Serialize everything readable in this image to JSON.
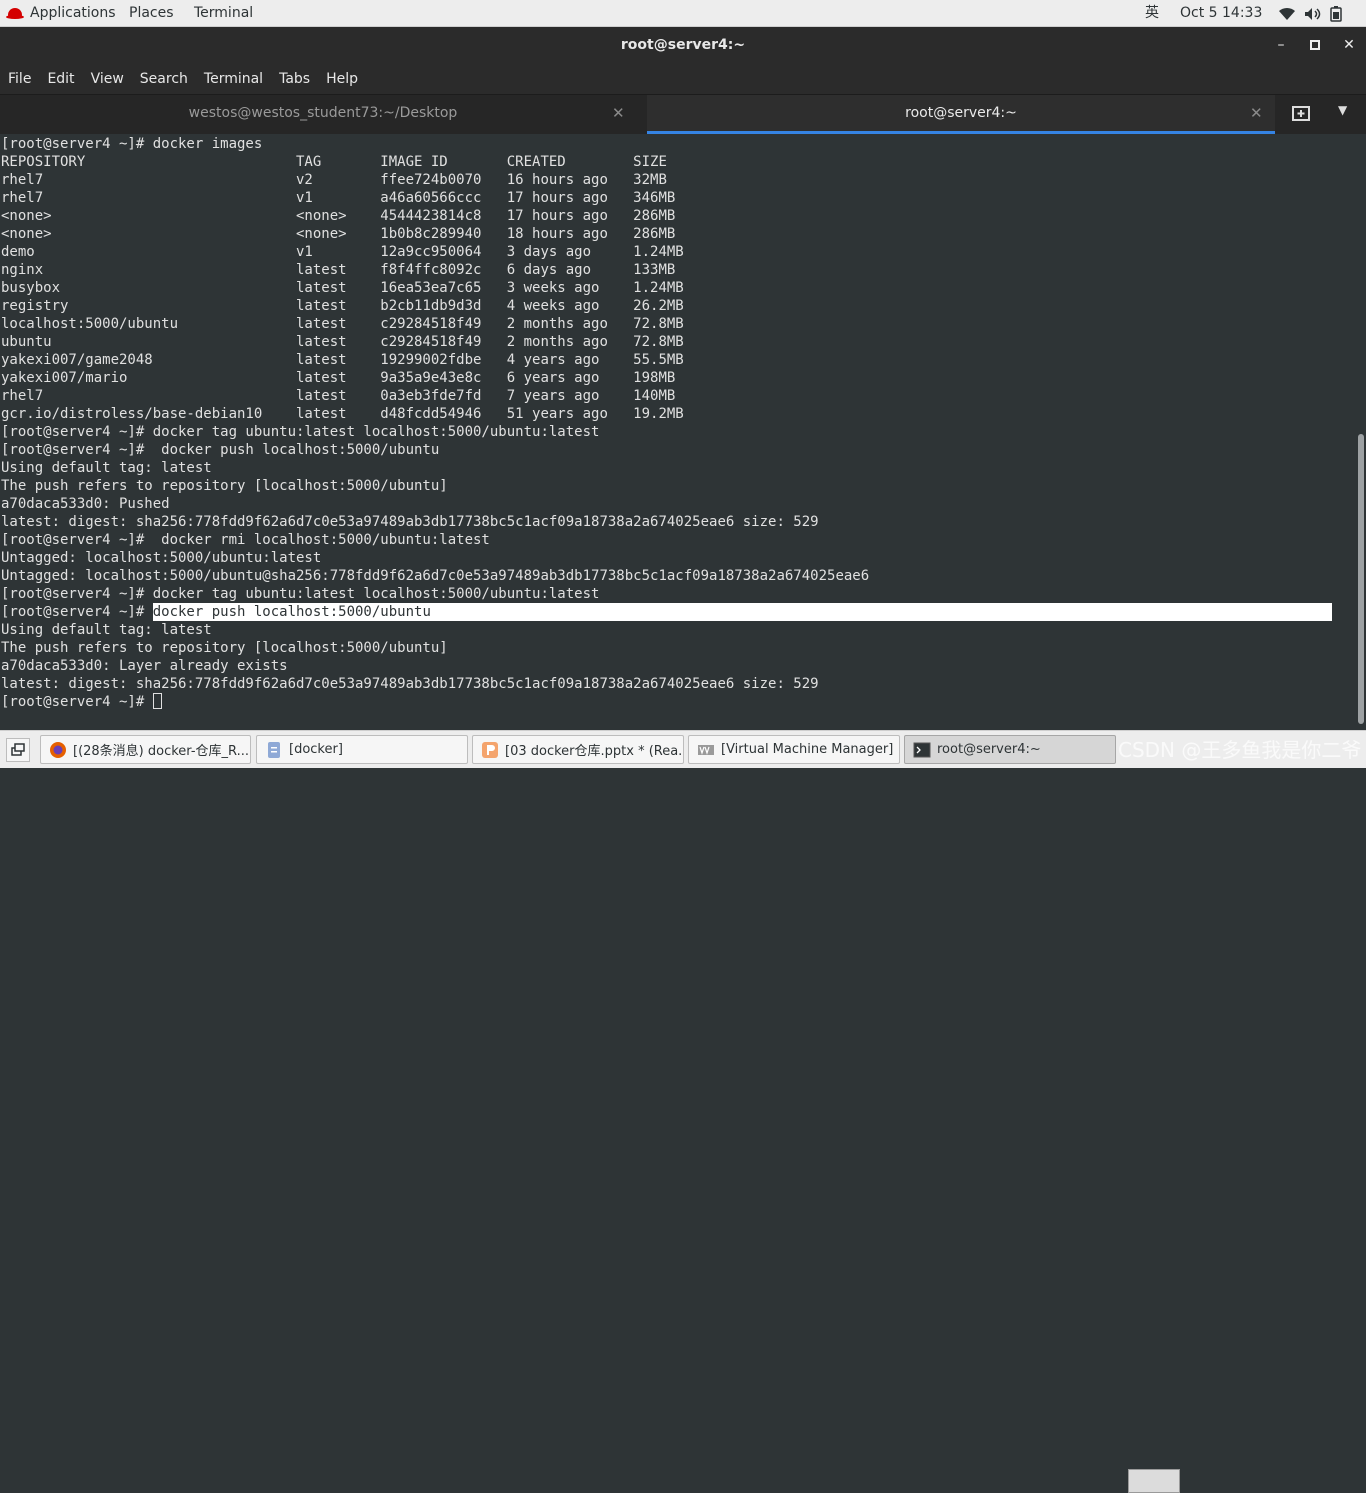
{
  "topbar": {
    "applications": "Applications",
    "places": "Places",
    "terminal": "Terminal",
    "input_method": "英",
    "clock": "Oct 5  14:33",
    "icons": [
      "wifi-icon",
      "volume-icon",
      "battery-icon"
    ]
  },
  "window": {
    "title": "root@server4:~",
    "controls": [
      "minimize-icon",
      "maximize-icon",
      "close-icon"
    ]
  },
  "menubar": [
    "File",
    "Edit",
    "View",
    "Search",
    "Terminal",
    "Tabs",
    "Help"
  ],
  "tabs": [
    {
      "label": "westos@westos_student73:~/Desktop",
      "active": false
    },
    {
      "label": "root@server4:~",
      "active": true
    }
  ],
  "terminal": {
    "lines": [
      "[root@server4 ~]# docker images",
      "REPOSITORY                         TAG       IMAGE ID       CREATED        SIZE",
      "rhel7                              v2        ffee724b0070   16 hours ago   32MB",
      "rhel7                              v1        a46a60566ccc   17 hours ago   346MB",
      "<none>                             <none>    4544423814c8   17 hours ago   286MB",
      "<none>                             <none>    1b0b8c289940   18 hours ago   286MB",
      "demo                               v1        12a9cc950064   3 days ago     1.24MB",
      "nginx                              latest    f8f4ffc8092c   6 days ago     133MB",
      "busybox                            latest    16ea53ea7c65   3 weeks ago    1.24MB",
      "registry                           latest    b2cb11db9d3d   4 weeks ago    26.2MB",
      "localhost:5000/ubuntu              latest    c29284518f49   2 months ago   72.8MB",
      "ubuntu                             latest    c29284518f49   2 months ago   72.8MB",
      "yakexi007/game2048                 latest    19299002fdbe   4 years ago    55.5MB",
      "yakexi007/mario                    latest    9a35a9e43e8c   6 years ago    198MB",
      "rhel7                              latest    0a3eb3fde7fd   7 years ago    140MB",
      "gcr.io/distroless/base-debian10    latest    d48fcdd54946   51 years ago   19.2MB",
      "[root@server4 ~]# docker tag ubuntu:latest localhost:5000/ubuntu:latest",
      "[root@server4 ~]#  docker push localhost:5000/ubuntu",
      "Using default tag: latest",
      "The push refers to repository [localhost:5000/ubuntu]",
      "a70daca533d0: Pushed",
      "latest: digest: sha256:778fdd9f62a6d7c0e53a97489ab3db17738bc5c1acf09a18738a2a674025eae6 size: 529",
      "[root@server4 ~]#  docker rmi localhost:5000/ubuntu:latest",
      "Untagged: localhost:5000/ubuntu:latest",
      "Untagged: localhost:5000/ubuntu@sha256:778fdd9f62a6d7c0e53a97489ab3db17738bc5c1acf09a18738a2a674025eae6",
      "[root@server4 ~]# docker tag ubuntu:latest localhost:5000/ubuntu:latest"
    ],
    "highlight_prompt": "[root@server4 ~]# ",
    "highlight_text": "docker push localhost:5000/ubuntu",
    "after_lines": [
      "Using default tag: latest",
      "The push refers to repository [localhost:5000/ubuntu]",
      "a70daca533d0: Layer already exists",
      "latest: digest: sha256:778fdd9f62a6d7c0e53a97489ab3db17738bc5c1acf09a18738a2a674025eae6 size: 529"
    ],
    "final_prompt": "[root@server4 ~]# "
  },
  "taskbar": [
    {
      "label": "[(28条消息) docker-仓库_R...",
      "icon": "firefox-icon",
      "active": false
    },
    {
      "label": "[docker]",
      "icon": "document-icon",
      "active": false
    },
    {
      "label": "[03 docker仓库.pptx * (Rea...",
      "icon": "presentation-icon",
      "active": false
    },
    {
      "label": "[Virtual Machine Manager]",
      "icon": "vm-manager-icon",
      "active": false
    },
    {
      "label": "root@server4:~",
      "icon": "terminal-icon",
      "active": true
    }
  ],
  "watermark": "CSDN @王多鱼我是你二爷",
  "colors": {
    "terminal_bg": "#2e3436",
    "tab_accent": "#3584e4",
    "redhat": "#d40000"
  }
}
